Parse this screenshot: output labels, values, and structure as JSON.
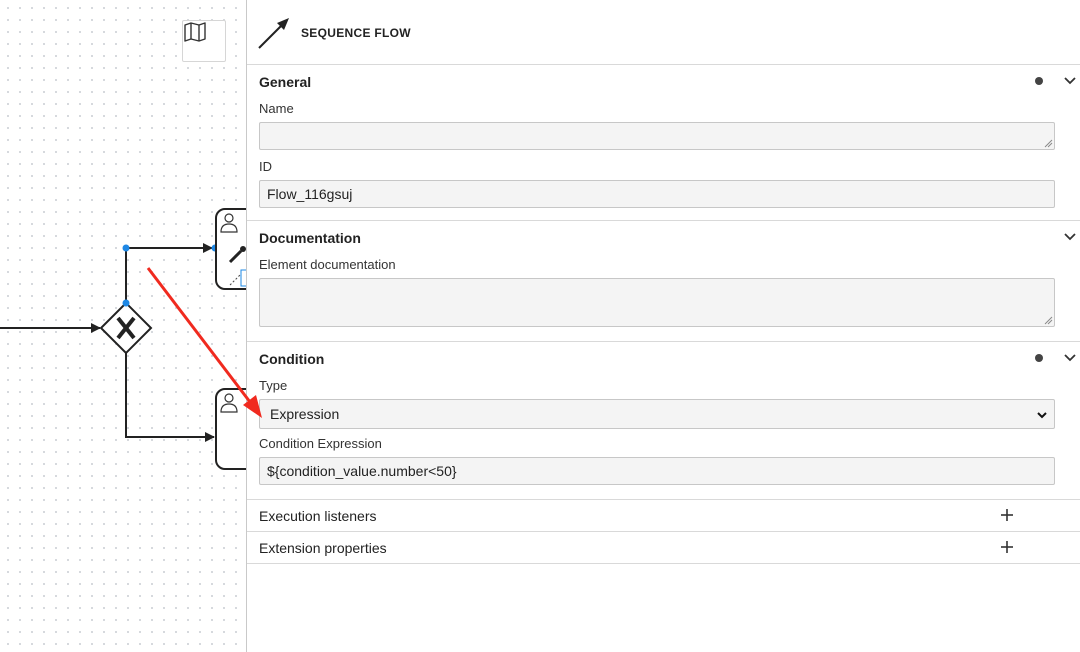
{
  "header": {
    "title": "SEQUENCE FLOW"
  },
  "groups": {
    "general": {
      "title": "General",
      "name_label": "Name",
      "name_value": "",
      "id_label": "ID",
      "id_value": "Flow_116gsuj"
    },
    "documentation": {
      "title": "Documentation",
      "doc_label": "Element documentation",
      "doc_value": ""
    },
    "condition": {
      "title": "Condition",
      "type_label": "Type",
      "type_value": "Expression",
      "expr_label": "Condition Expression",
      "expr_value": "${condition_value.number<50}"
    },
    "execution_listeners": {
      "title": "Execution listeners"
    },
    "extension_properties": {
      "title": "Extension properties"
    }
  },
  "icons": {
    "map": "map-icon",
    "header": "sequence-flow-arrow-icon",
    "gateway": "exclusive-gateway-x-icon",
    "user_task": "user-task-icon"
  },
  "colors": {
    "annotation_arrow": "#f02a1f",
    "selection_handle": "#1e88e5",
    "status_dot": "#444444"
  }
}
